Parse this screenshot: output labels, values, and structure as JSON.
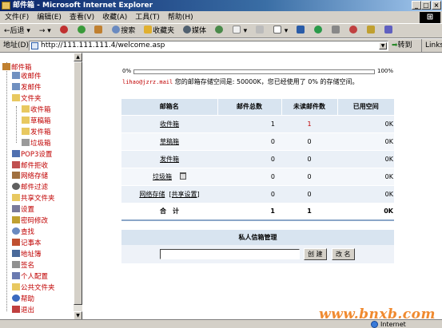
{
  "window": {
    "title": "邮件箱 - Microsoft Internet Explorer"
  },
  "menu": [
    "文件(F)",
    "编辑(E)",
    "查看(V)",
    "收藏(A)",
    "工具(T)",
    "帮助(H)"
  ],
  "toolbar": [
    {
      "label": "←后退",
      "icon": "back-icon"
    },
    {
      "label": "→",
      "icon": "forward-icon"
    },
    {
      "label": "",
      "icon": "stop-icon"
    },
    {
      "label": "",
      "icon": "refresh-icon"
    },
    {
      "label": "",
      "icon": "home-icon"
    },
    {
      "label": "搜索",
      "icon": "search-icon"
    },
    {
      "label": "收藏夹",
      "icon": "favorites-icon"
    },
    {
      "label": "媒体",
      "icon": "media-icon"
    },
    {
      "label": "",
      "icon": "history-icon"
    },
    {
      "label": "",
      "icon": "mail-icon"
    },
    {
      "label": "",
      "icon": "print-icon"
    },
    {
      "label": "",
      "icon": "edit-icon"
    },
    {
      "label": "",
      "icon": "discuss-icon"
    },
    {
      "label": "",
      "icon": "messenger-icon"
    }
  ],
  "address": {
    "label": "地址(D)",
    "url": "http://111.111.111.4/welcome.asp",
    "go": "转到",
    "links": "Links"
  },
  "sidebar": {
    "items": [
      {
        "label": "邮件箱",
        "icon": "mailbox-icon"
      },
      {
        "label": "收邮件",
        "icon": "receive-mail-icon"
      },
      {
        "label": "发邮件",
        "icon": "send-mail-icon"
      },
      {
        "label": "文件夹",
        "icon": "folder-open-icon"
      },
      {
        "label": "收件箱",
        "icon": "folder-icon"
      },
      {
        "label": "草稿箱",
        "icon": "folder-icon"
      },
      {
        "label": "发件箱",
        "icon": "folder-icon"
      },
      {
        "label": "垃圾箱",
        "icon": "trash-folder-icon"
      },
      {
        "label": "POP3设置",
        "icon": "pop3-icon"
      },
      {
        "label": "邮件拒收",
        "icon": "reject-icon"
      },
      {
        "label": "网络存储",
        "icon": "storage-icon"
      },
      {
        "label": "邮件过滤",
        "icon": "filter-icon"
      },
      {
        "label": "共享文件夹",
        "icon": "shared-folder-icon"
      },
      {
        "label": "设置",
        "icon": "settings-icon"
      },
      {
        "label": "密码修改",
        "icon": "password-icon"
      },
      {
        "label": "查找",
        "icon": "find-icon"
      },
      {
        "label": "记事本",
        "icon": "notepad-icon"
      },
      {
        "label": "地址簿",
        "icon": "addressbook-icon"
      },
      {
        "label": "签名",
        "icon": "signature-icon"
      },
      {
        "label": "个人配置",
        "icon": "profile-icon"
      },
      {
        "label": "公共文件夹",
        "icon": "public-folder-icon"
      },
      {
        "label": "帮助",
        "icon": "help-icon"
      },
      {
        "label": "退出",
        "icon": "logout-icon"
      }
    ]
  },
  "quota": {
    "min": "0%",
    "max": "100%",
    "used_fraction": 0.0,
    "email": "lihao@jzrz.mail",
    "text": " 您的邮箱存储空间是: 50000K，您已经使用了 0% 的存储空间。"
  },
  "folders": {
    "headers": [
      "邮箱名",
      "邮件总数",
      "未读邮件数",
      "已用空间"
    ],
    "rows": [
      {
        "name": "收件箱",
        "total": "1",
        "unread": "1",
        "used": "0K"
      },
      {
        "name": "草稿箱",
        "total": "0",
        "unread": "0",
        "used": "0K"
      },
      {
        "name": "发件箱",
        "total": "0",
        "unread": "0",
        "used": "0K"
      },
      {
        "name": "垃圾箱",
        "total": "0",
        "unread": "0",
        "used": "0K"
      },
      {
        "name": "网络存储",
        "extra": "[共享设置]",
        "total": "0",
        "unread": "0",
        "used": "0K"
      }
    ],
    "total": {
      "label": "合　计",
      "total": "1",
      "unread": "1",
      "used": "0K"
    }
  },
  "private_folder": {
    "title": "私人信箱管理",
    "input_value": "",
    "create": "创 建",
    "rename": "改 名"
  },
  "watermark": "www.bnxb.com",
  "status": {
    "zone": "Internet"
  },
  "colors": {
    "title_bar": "#0a246a",
    "sidebar_text": "#c00000",
    "table_header": "#d8e4f0",
    "watermark": "#f08a30"
  }
}
